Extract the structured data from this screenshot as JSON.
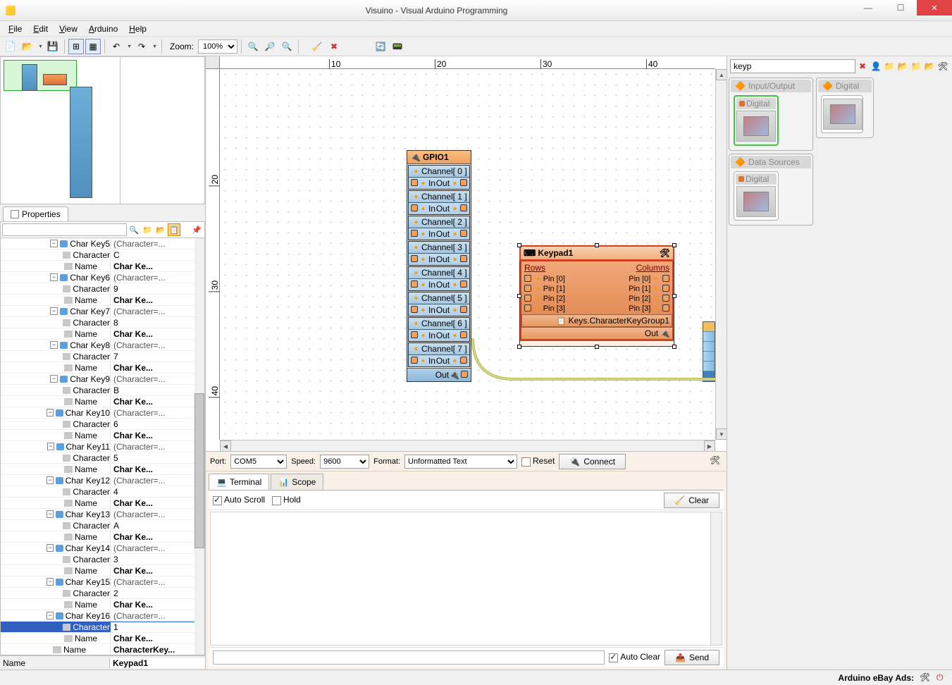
{
  "window": {
    "title": "Visuino - Visual Arduino Programming"
  },
  "menu": {
    "file": "File",
    "edit": "Edit",
    "view": "View",
    "arduino": "Arduino",
    "help": "Help"
  },
  "toolbar": {
    "zoom_label": "Zoom:",
    "zoom_value": "100%"
  },
  "properties": {
    "tab": "Properties",
    "footer_name_label": "Name",
    "footer_name_value": "Keypad1",
    "rows": [
      {
        "t": "head",
        "lvl": 2,
        "name": "Char Key5",
        "val": "(Character=..."
      },
      {
        "t": "prop",
        "lvl": 3,
        "ico": "gray",
        "name": "Character",
        "val": "C"
      },
      {
        "t": "prop",
        "lvl": 3,
        "ico": "gray",
        "name": "Name",
        "val": "Char Ke...",
        "b": true
      },
      {
        "t": "head",
        "lvl": 2,
        "name": "Char Key6",
        "val": "(Character=..."
      },
      {
        "t": "prop",
        "lvl": 3,
        "ico": "gray",
        "name": "Character",
        "val": "9"
      },
      {
        "t": "prop",
        "lvl": 3,
        "ico": "gray",
        "name": "Name",
        "val": "Char Ke...",
        "b": true
      },
      {
        "t": "head",
        "lvl": 2,
        "name": "Char Key7",
        "val": "(Character=..."
      },
      {
        "t": "prop",
        "lvl": 3,
        "ico": "gray",
        "name": "Character",
        "val": "8"
      },
      {
        "t": "prop",
        "lvl": 3,
        "ico": "gray",
        "name": "Name",
        "val": "Char Ke...",
        "b": true
      },
      {
        "t": "head",
        "lvl": 2,
        "name": "Char Key8",
        "val": "(Character=..."
      },
      {
        "t": "prop",
        "lvl": 3,
        "ico": "gray",
        "name": "Character",
        "val": "7"
      },
      {
        "t": "prop",
        "lvl": 3,
        "ico": "gray",
        "name": "Name",
        "val": "Char Ke...",
        "b": true
      },
      {
        "t": "head",
        "lvl": 2,
        "name": "Char Key9",
        "val": "(Character=..."
      },
      {
        "t": "prop",
        "lvl": 3,
        "ico": "gray",
        "name": "Character",
        "val": "B"
      },
      {
        "t": "prop",
        "lvl": 3,
        "ico": "gray",
        "name": "Name",
        "val": "Char Ke...",
        "b": true
      },
      {
        "t": "head",
        "lvl": 2,
        "name": "Char Key10",
        "val": "(Character=..."
      },
      {
        "t": "prop",
        "lvl": 3,
        "ico": "gray",
        "name": "Character",
        "val": "6"
      },
      {
        "t": "prop",
        "lvl": 3,
        "ico": "gray",
        "name": "Name",
        "val": "Char Ke...",
        "b": true
      },
      {
        "t": "head",
        "lvl": 2,
        "name": "Char Key11",
        "val": "(Character=..."
      },
      {
        "t": "prop",
        "lvl": 3,
        "ico": "gray",
        "name": "Character",
        "val": "5"
      },
      {
        "t": "prop",
        "lvl": 3,
        "ico": "gray",
        "name": "Name",
        "val": "Char Ke...",
        "b": true
      },
      {
        "t": "head",
        "lvl": 2,
        "name": "Char Key12",
        "val": "(Character=..."
      },
      {
        "t": "prop",
        "lvl": 3,
        "ico": "gray",
        "name": "Character",
        "val": "4"
      },
      {
        "t": "prop",
        "lvl": 3,
        "ico": "gray",
        "name": "Name",
        "val": "Char Ke...",
        "b": true
      },
      {
        "t": "head",
        "lvl": 2,
        "name": "Char Key13",
        "val": "(Character=..."
      },
      {
        "t": "prop",
        "lvl": 3,
        "ico": "gray",
        "name": "Character",
        "val": "A"
      },
      {
        "t": "prop",
        "lvl": 3,
        "ico": "gray",
        "name": "Name",
        "val": "Char Ke...",
        "b": true
      },
      {
        "t": "head",
        "lvl": 2,
        "name": "Char Key14",
        "val": "(Character=..."
      },
      {
        "t": "prop",
        "lvl": 3,
        "ico": "gray",
        "name": "Character",
        "val": "3"
      },
      {
        "t": "prop",
        "lvl": 3,
        "ico": "gray",
        "name": "Name",
        "val": "Char Ke...",
        "b": true
      },
      {
        "t": "head",
        "lvl": 2,
        "name": "Char Key15",
        "val": "(Character=..."
      },
      {
        "t": "prop",
        "lvl": 3,
        "ico": "gray",
        "name": "Character",
        "val": "2"
      },
      {
        "t": "prop",
        "lvl": 3,
        "ico": "gray",
        "name": "Name",
        "val": "Char Ke...",
        "b": true
      },
      {
        "t": "head",
        "lvl": 2,
        "name": "Char Key16",
        "val": "(Character=..."
      },
      {
        "t": "prop",
        "lvl": 3,
        "ico": "gray",
        "name": "Character",
        "val": "1",
        "sel": true
      },
      {
        "t": "prop",
        "lvl": 3,
        "ico": "gray",
        "name": "Name",
        "val": "Char Ke...",
        "b": true
      },
      {
        "t": "prop",
        "lvl": 2,
        "ico": "gray",
        "name": "Name",
        "val": "CharacterKey...",
        "b": true
      }
    ]
  },
  "canvas": {
    "ruler_h": [
      "10",
      "20",
      "30",
      "40"
    ],
    "ruler_v": [
      "20",
      "30",
      "40"
    ],
    "gpio": {
      "title": "GPIO1",
      "channels": [
        "Channel[ 0 ]",
        "Channel[ 1 ]",
        "Channel[ 2 ]",
        "Channel[ 3 ]",
        "Channel[ 4 ]",
        "Channel[ 5 ]",
        "Channel[ 6 ]",
        "Channel[ 7 ]"
      ],
      "in": "In",
      "out": "Out",
      "out_foot": "Out"
    },
    "keypad": {
      "title": "Keypad1",
      "rows_hdr": "Rows",
      "cols_hdr": "Columns",
      "row_pins": [
        "Pin [0]",
        "Pin [1]",
        "Pin [2]",
        "Pin [3]"
      ],
      "col_pins": [
        "Pin [0]",
        "Pin [1]",
        "Pin [2]",
        "Pin [3]"
      ],
      "keys_group": "Keys.CharacterKeyGroup1",
      "out": "Out"
    }
  },
  "terminal": {
    "port_lbl": "Port:",
    "port_val": "COM5",
    "speed_lbl": "Speed:",
    "speed_val": "9600",
    "format_lbl": "Format:",
    "format_val": "Unformatted Text",
    "reset": "Reset",
    "connect": "Connect",
    "tab_terminal": "Terminal",
    "tab_scope": "Scope",
    "autoscroll": "Auto Scroll",
    "hold": "Hold",
    "clear": "Clear",
    "autoclear": "Auto Clear",
    "send": "Send"
  },
  "palette": {
    "search": "keyp",
    "g1": "Input/Output",
    "g2": "Digital",
    "g3": "Data Sources",
    "item": "Digital"
  },
  "statusbar": {
    "ads": "Arduino eBay Ads:"
  }
}
